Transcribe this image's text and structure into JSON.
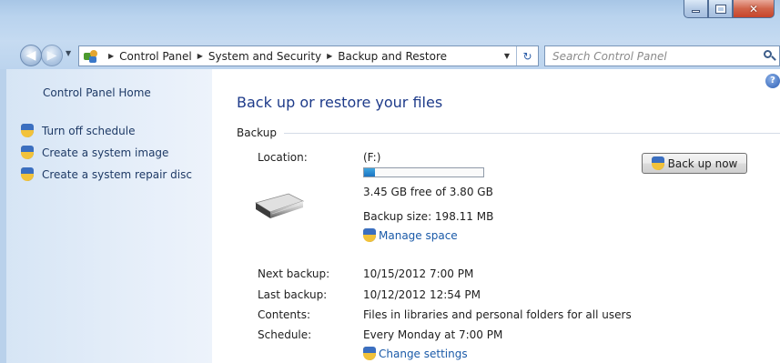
{
  "window": {
    "caption_buttons": [
      "minimize",
      "maximize",
      "close"
    ]
  },
  "nav": {
    "breadcrumbs": [
      "Control Panel",
      "System and Security",
      "Backup and Restore"
    ],
    "search_placeholder": "Search Control Panel"
  },
  "sidebar": {
    "home_label": "Control Panel Home",
    "tasks": [
      {
        "label": "Turn off schedule",
        "icon": "uac-shield-icon"
      },
      {
        "label": "Create a system image",
        "icon": "uac-shield-icon"
      },
      {
        "label": "Create a system repair disc",
        "icon": "uac-shield-icon"
      }
    ]
  },
  "main": {
    "title": "Back up or restore your files",
    "section": "Backup",
    "location_label": "Location:",
    "location_value": "(F:)",
    "drive_usage_fraction": 0.09,
    "free_space": "3.45 GB free of 3.80 GB",
    "backup_size": "Backup size: 198.11 MB",
    "manage_space_label": "Manage space",
    "back_up_now_label": "Back up now",
    "details": [
      {
        "label": "Next backup:",
        "value": "10/15/2012 7:00 PM"
      },
      {
        "label": "Last backup:",
        "value": "10/12/2012 12:54 PM"
      },
      {
        "label": "Contents:",
        "value": "Files in libraries and personal folders for all users"
      },
      {
        "label": "Schedule:",
        "value": "Every Monday at 7:00 PM"
      }
    ],
    "change_settings_label": "Change settings"
  },
  "colors": {
    "link": "#1a5aa8",
    "title": "#1e3b8a",
    "progress_fill": "#1b74c2"
  }
}
